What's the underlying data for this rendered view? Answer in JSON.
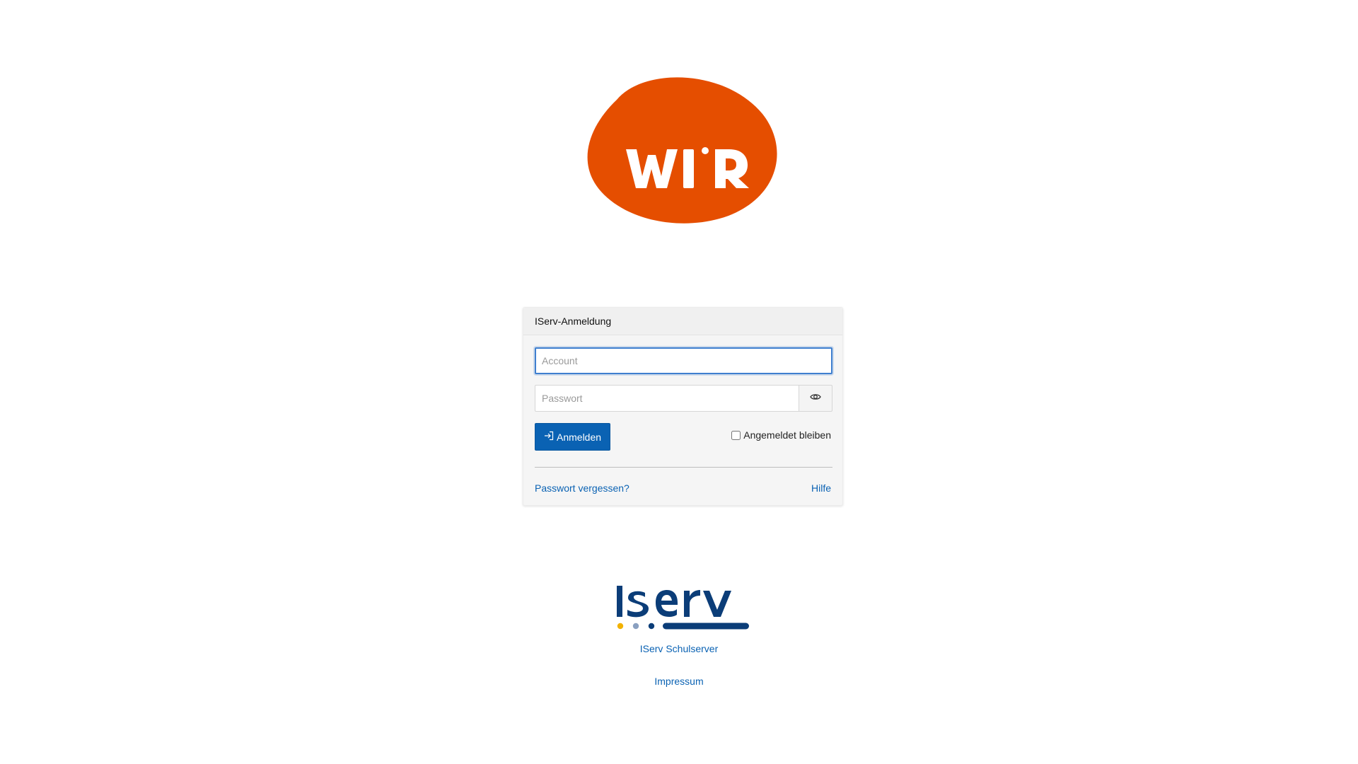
{
  "school_logo": {
    "text": "WIR",
    "color": "#e65100",
    "text_color": "#ffffff"
  },
  "login": {
    "title": "IServ-Anmeldung",
    "account_placeholder": "Account",
    "account_value": "",
    "password_placeholder": "Passwort",
    "password_value": "",
    "show_password_icon": "eye-icon",
    "submit_icon": "login-arrow-icon",
    "submit_label": "Anmelden",
    "remember_label": "Angemeldet bleiben",
    "remember_checked": false,
    "forgot_label": "Passwort vergessen?",
    "help_label": "Hilfe",
    "accent_color": "#0a62b3"
  },
  "footer": {
    "brand_logo": "iserv",
    "brand_color": "#0b3d78",
    "product_link": "IServ Schulserver",
    "impressum_link": "Impressum"
  }
}
